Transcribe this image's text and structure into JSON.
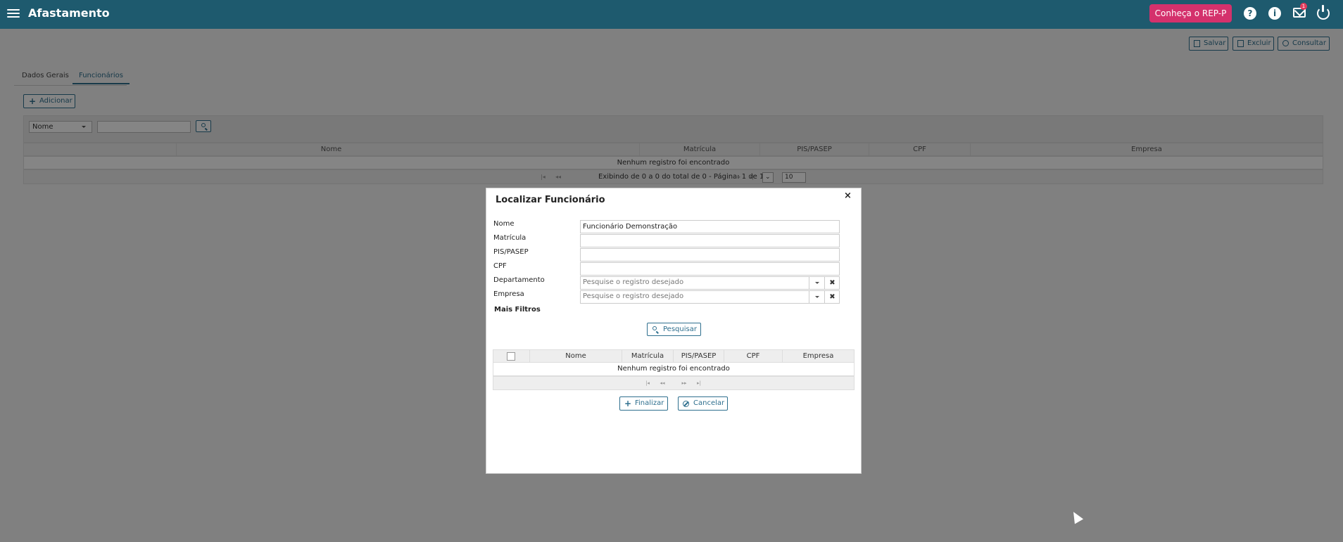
{
  "header": {
    "title": "Afastamento",
    "promo_button": "Conheça o REP-P",
    "help_icon": "question-circle-icon",
    "info_icon": "info-circle-icon",
    "mail_icon": "envelope-icon",
    "mail_badge": "1",
    "power_icon": "power-icon",
    "menu_icon": "hamburger-icon",
    "bar_color": "#1e5a6e",
    "promo_color": "#d4316c"
  },
  "toolbar": {
    "save_label": "Salvar",
    "delete_label": "Excluir",
    "query_label": "Consultar"
  },
  "tabs": [
    {
      "label": "Dados Gerais",
      "active": false
    },
    {
      "label": "Funcionários",
      "active": true
    }
  ],
  "add_button": "Adicionar",
  "filter": {
    "select_value": "Nome",
    "input_value": ""
  },
  "grid": {
    "columns": [
      "Nome",
      "Matrícula",
      "PIS/PASEP",
      "CPF",
      "Empresa"
    ],
    "empty_message": "Nenhum registro foi encontrado",
    "pager_text": "Exibindo de 0 a 0 do total de 0 - Página: 1 de 1",
    "page_size": "10"
  },
  "modal": {
    "title": "Localizar Funcionário",
    "close_symbol": "×",
    "fields": {
      "nome_label": "Nome",
      "nome_value": "Funcionário Demonstração",
      "matricula_label": "Matrícula",
      "pis_label": "PIS/PASEP",
      "cpf_label": "CPF",
      "departamento_label": "Departamento",
      "departamento_placeholder": "Pesquise o registro desejado",
      "empresa_label": "Empresa",
      "empresa_placeholder": "Pesquise o registro desejado"
    },
    "more_filters": "Mais Filtros",
    "search_button": "Pesquisar",
    "results": {
      "columns": [
        "Nome",
        "Matrícula",
        "PIS/PASEP",
        "CPF",
        "Empresa"
      ],
      "empty_message": "Nenhum registro foi encontrado"
    },
    "finish_button": "Finalizar",
    "cancel_button": "Cancelar"
  }
}
